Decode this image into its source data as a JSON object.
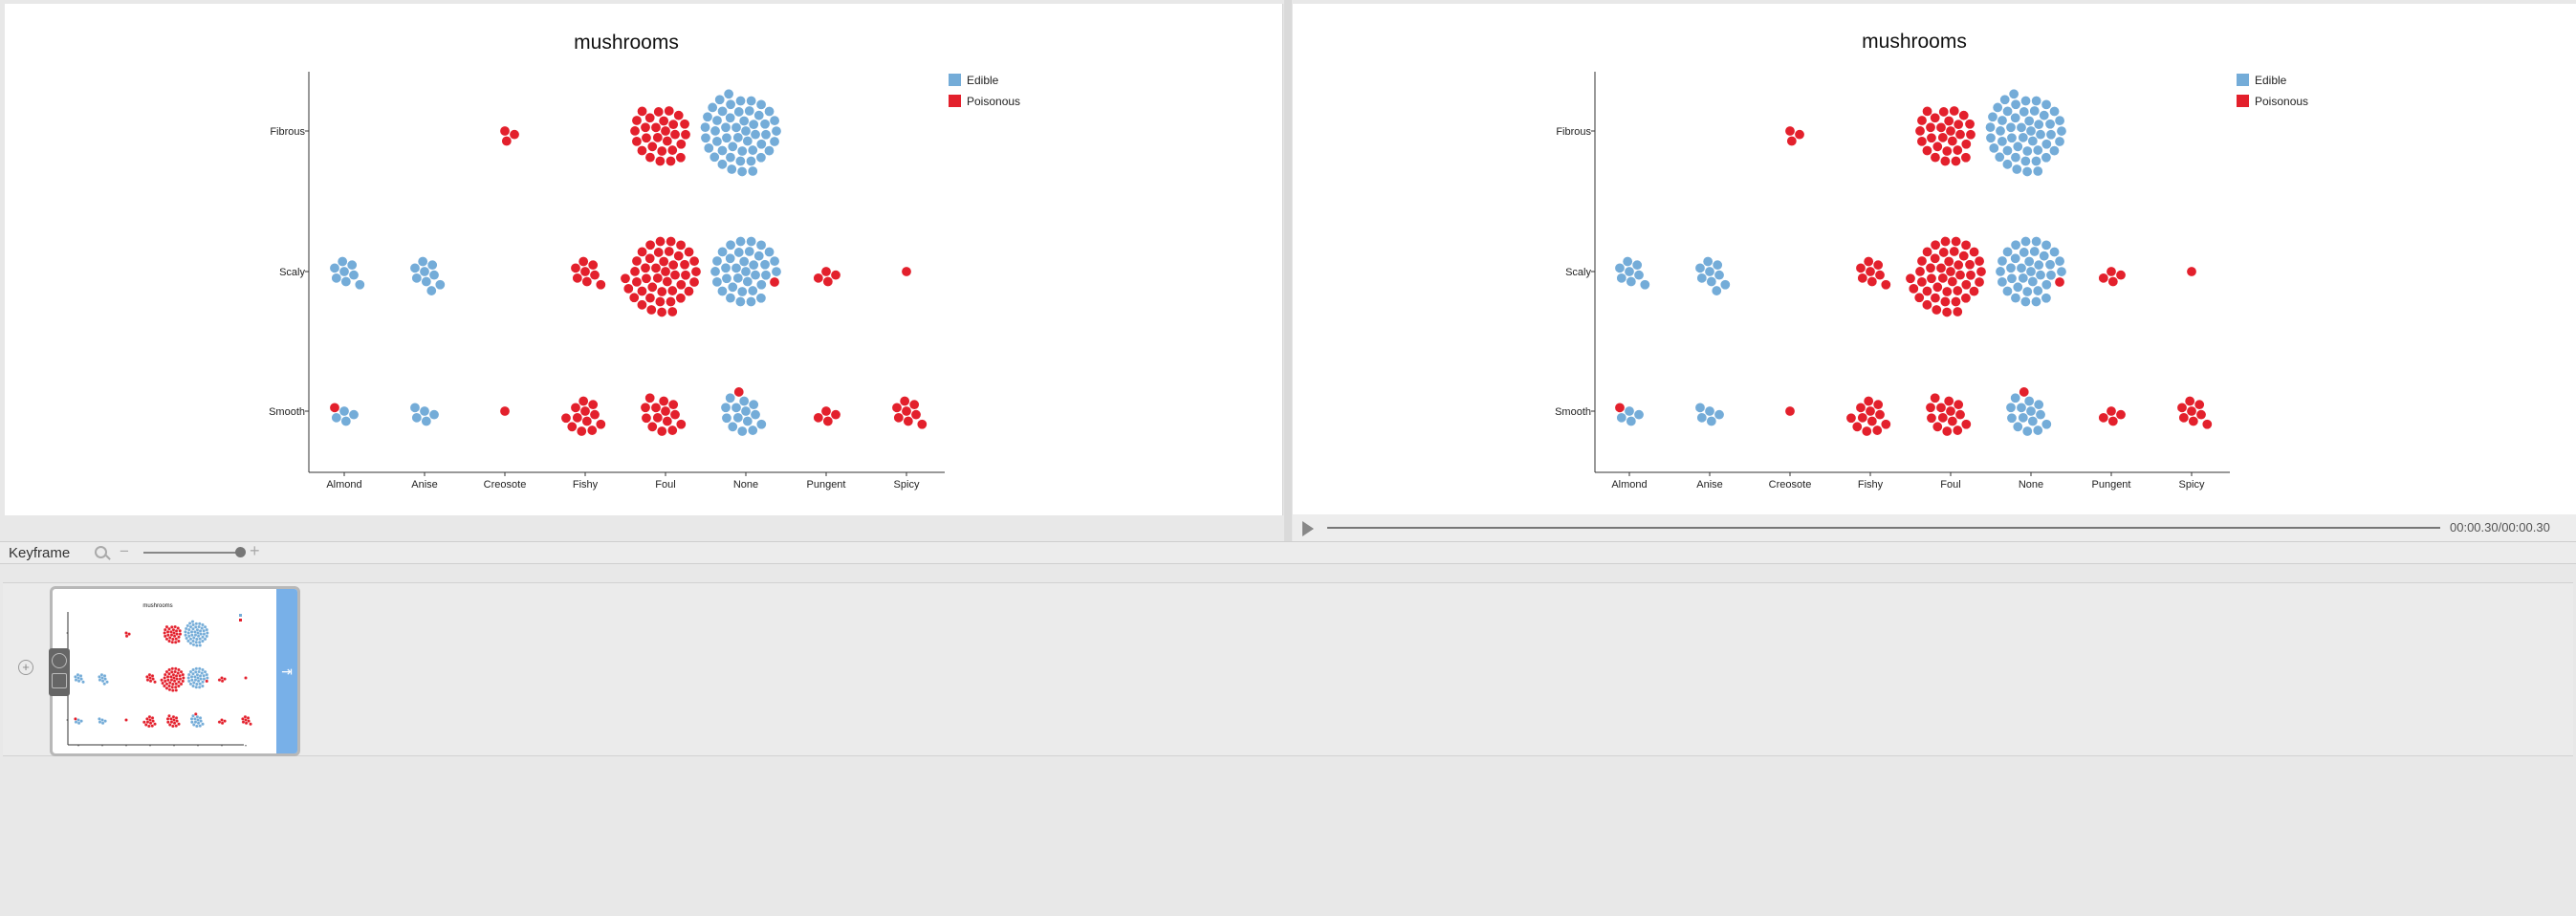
{
  "chart_data": {
    "type": "scatter",
    "subtype": "beeswarm",
    "title": "mushrooms",
    "xlabel": "",
    "ylabel": "",
    "categories": [
      "Almond",
      "Anise",
      "Creosote",
      "Fishy",
      "Foul",
      "None",
      "Pungent",
      "Spicy"
    ],
    "rows": [
      "Fibrous",
      "Scaly",
      "Smooth"
    ],
    "legend": {
      "position": "top-right",
      "entries": [
        {
          "name": "Edible",
          "color": "#74acd8"
        },
        {
          "name": "Poisonous",
          "color": "#e3202c"
        }
      ]
    },
    "grid": false,
    "series": [
      {
        "name": "Edible",
        "color": "#74acd8",
        "counts": {
          "Fibrous": [
            0,
            0,
            0,
            0,
            0,
            49,
            0,
            0
          ],
          "Scaly": [
            8,
            9,
            0,
            0,
            0,
            35,
            0,
            0
          ],
          "Smooth": [
            4,
            5,
            0,
            0,
            0,
            14,
            0,
            0
          ]
        }
      },
      {
        "name": "Poisonous",
        "color": "#e3202c",
        "counts": {
          "Fibrous": [
            0,
            0,
            3,
            0,
            28,
            0,
            0,
            0
          ],
          "Scaly": [
            0,
            0,
            0,
            8,
            44,
            1,
            4,
            1
          ],
          "Smooth": [
            1,
            0,
            1,
            12,
            14,
            1,
            4,
            8
          ]
        }
      }
    ]
  },
  "preview_player": {
    "time": "00:00.30/00:00.30",
    "progress": 1.0
  },
  "keyframe_toolbar": {
    "label": "Keyframe",
    "zoom_out_label": "−",
    "zoom_in_label": "+",
    "zoom_level": 0.92
  },
  "timeline": {
    "add_label": "+",
    "keyframe_handle_label": "⇥"
  }
}
